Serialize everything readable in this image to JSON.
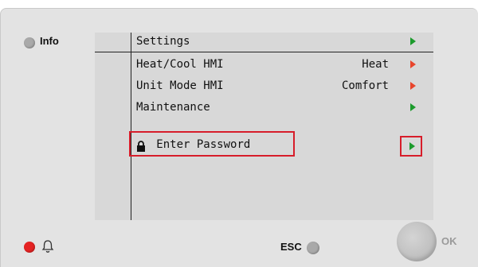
{
  "panel": {
    "info_label": "Info",
    "esc_label": "ESC",
    "ok_label": "OK"
  },
  "menu": {
    "title": "Settings",
    "items": [
      {
        "label": "Heat/Cool HMI",
        "value": "Heat",
        "arrow_color": "#e8452c"
      },
      {
        "label": "Unit Mode HMI",
        "value": "Comfort",
        "arrow_color": "#e8452c"
      },
      {
        "label": "Maintenance",
        "value": "",
        "arrow_color": "#1c9b2c"
      }
    ],
    "password_label": "Enter Password"
  },
  "colors": {
    "arrow_green": "#1c9b2c",
    "arrow_red": "#e8452c",
    "highlight_red": "#d71d2a",
    "alarm_led": "#e52323",
    "screen_bg": "#d8d8d8"
  },
  "icons": [
    "lock-icon",
    "bell-icon",
    "arrow-right-icon"
  ]
}
